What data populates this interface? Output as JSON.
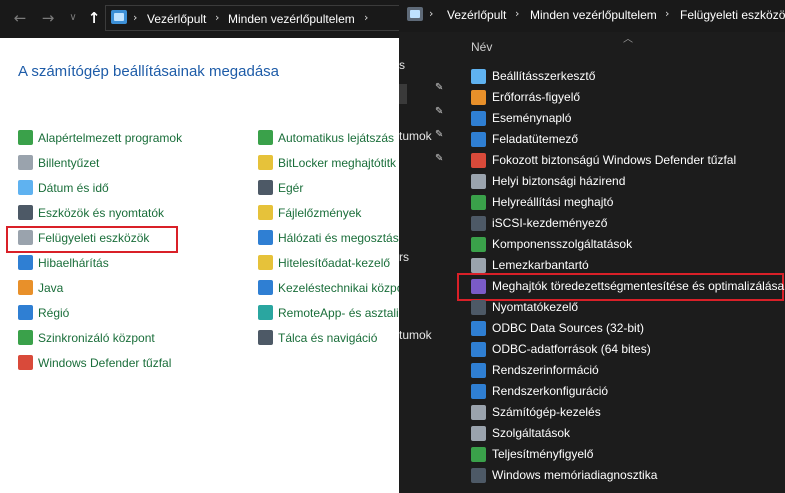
{
  "left_window": {
    "breadcrumb": [
      "Vezérlőpult",
      "Minden vezérlőpultelem"
    ],
    "title": "A számítógép beállításainak megadása",
    "col1": [
      {
        "label": "Alapértelmezett programok",
        "icon": "default-programs-icon",
        "color": "#3aa14a"
      },
      {
        "label": "Billentyűzet",
        "icon": "keyboard-icon",
        "color": "#9aa3ad"
      },
      {
        "label": "Dátum és idő",
        "icon": "clock-icon",
        "color": "#5fb2f0"
      },
      {
        "label": "Eszközök és nyomtatók",
        "icon": "printer-icon",
        "color": "#4d5966"
      },
      {
        "label": "Felügyeleti eszközök",
        "icon": "admin-tools-icon",
        "color": "#9aa3ad"
      },
      {
        "label": "Hibaelhárítás",
        "icon": "troubleshoot-icon",
        "color": "#2f7fd3"
      },
      {
        "label": "Java",
        "icon": "java-icon",
        "color": "#e8902a"
      },
      {
        "label": "Régió",
        "icon": "globe-icon",
        "color": "#2f7fd3"
      },
      {
        "label": "Szinkronizáló központ",
        "icon": "sync-icon",
        "color": "#3aa14a"
      },
      {
        "label": "Windows Defender tűzfal",
        "icon": "firewall-icon",
        "color": "#d94a3a"
      }
    ],
    "col2": [
      {
        "label": "Automatikus lejátszás",
        "icon": "autoplay-icon",
        "color": "#3aa14a"
      },
      {
        "label": "BitLocker meghajtótitk",
        "icon": "bitlocker-icon",
        "color": "#e6c23a"
      },
      {
        "label": "Egér",
        "icon": "mouse-icon",
        "color": "#4d5966"
      },
      {
        "label": "Fájlelőzmények",
        "icon": "file-history-icon",
        "color": "#e6c23a"
      },
      {
        "label": "Hálózati és megosztás",
        "icon": "network-icon",
        "color": "#2f7fd3"
      },
      {
        "label": "Hitelesítőadat-kezelő",
        "icon": "credential-icon",
        "color": "#e6c23a"
      },
      {
        "label": "Kezeléstechnikai közpo",
        "icon": "ease-of-access-icon",
        "color": "#2f7fd3"
      },
      {
        "label": "RemoteApp- és asztali",
        "icon": "remoteapp-icon",
        "color": "#2aa6a0"
      },
      {
        "label": "Tálca és navigáció",
        "icon": "taskbar-icon",
        "color": "#4d5966"
      }
    ],
    "highlighted_item": "Felügyeleti eszközök"
  },
  "right_window": {
    "breadcrumb": [
      "Vezérlőpult",
      "Minden vezérlőpultelem",
      "Felügyeleti eszközök"
    ],
    "column_header": "Név",
    "sidebar_fragments": [
      "s",
      "tumok",
      "rs",
      "tumok"
    ],
    "items": [
      {
        "label": "Beállításszerkesztő",
        "icon": "registry-icon",
        "color": "#5fb2f0"
      },
      {
        "label": "Erőforrás-figyelő",
        "icon": "resource-monitor-icon",
        "color": "#e8902a"
      },
      {
        "label": "Eseménynapló",
        "icon": "event-viewer-icon",
        "color": "#2f7fd3"
      },
      {
        "label": "Feladatütemező",
        "icon": "task-scheduler-icon",
        "color": "#2f7fd3"
      },
      {
        "label": "Fokozott biztonságú Windows Defender tűzfal",
        "icon": "firewall-icon",
        "color": "#d94a3a"
      },
      {
        "label": "Helyi biztonsági házirend",
        "icon": "security-policy-icon",
        "color": "#9aa3ad"
      },
      {
        "label": "Helyreállítási meghajtó",
        "icon": "recovery-drive-icon",
        "color": "#3aa14a"
      },
      {
        "label": "iSCSI-kezdeményező",
        "icon": "iscsi-icon",
        "color": "#4d5966"
      },
      {
        "label": "Komponensszolgáltatások",
        "icon": "component-services-icon",
        "color": "#3aa14a"
      },
      {
        "label": "Lemezkarbantartó",
        "icon": "disk-cleanup-icon",
        "color": "#9aa3ad"
      },
      {
        "label": "Meghajtók töredezettségmentesítése és optimalizálása",
        "icon": "defrag-icon",
        "color": "#7a5bc7"
      },
      {
        "label": "Nyomtatókezelő",
        "icon": "print-management-icon",
        "color": "#4d5966"
      },
      {
        "label": "ODBC Data Sources (32-bit)",
        "icon": "odbc-icon",
        "color": "#2f7fd3"
      },
      {
        "label": "ODBC-adatforrások (64 bites)",
        "icon": "odbc-icon",
        "color": "#2f7fd3"
      },
      {
        "label": "Rendszerinformáció",
        "icon": "system-info-icon",
        "color": "#2f7fd3"
      },
      {
        "label": "Rendszerkonfiguráció",
        "icon": "system-config-icon",
        "color": "#2f7fd3"
      },
      {
        "label": "Számítógép-kezelés",
        "icon": "computer-management-icon",
        "color": "#9aa3ad"
      },
      {
        "label": "Szolgáltatások",
        "icon": "services-icon",
        "color": "#9aa3ad"
      },
      {
        "label": "Teljesítményfigyelő",
        "icon": "performance-monitor-icon",
        "color": "#3aa14a"
      },
      {
        "label": "Windows memóriadiagnosztika",
        "icon": "memory-diagnostic-icon",
        "color": "#4d5966"
      }
    ],
    "highlighted_item": "Meghajtók töredezettségmentesítése és optimalizálása"
  }
}
